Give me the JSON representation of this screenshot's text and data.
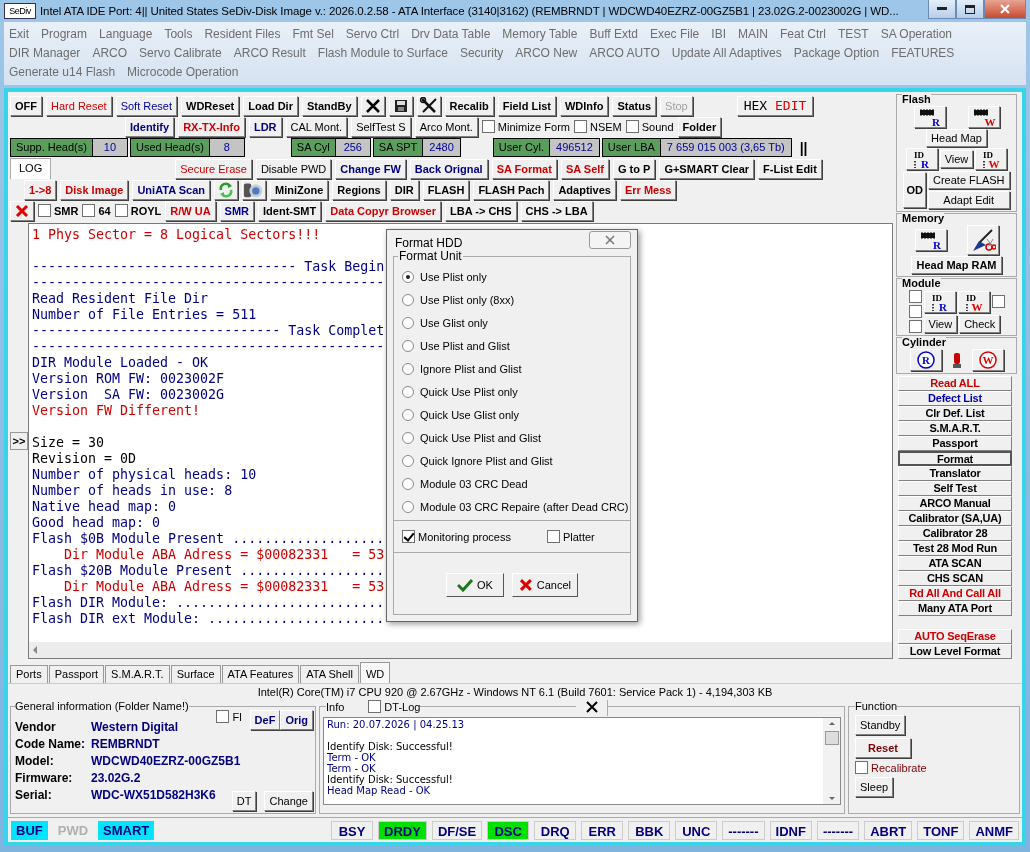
{
  "window": {
    "app_icon": "SeDiv",
    "title": "Intel ATA IDE  Port: 4|| United States  SeDiv-Disk Image v.: 2026.0.2.58 - ATA Interface (3140|3162)  (REMBRNDT | WDCWD40EZRZ-00GZ5B1 | 23.02G.2-0023002G | WD..."
  },
  "menu": [
    [
      "Exit",
      "Program",
      "Language",
      "Tools",
      "Resident Files",
      "Fmt Sel",
      "Servo Ctrl",
      "Drv Data Table",
      "Memory Table",
      "Buff Extd",
      "Exec File",
      "IBI",
      "MAIN",
      "Feat Ctrl",
      "TEST",
      "SA Operation"
    ],
    [
      "DIR Manager",
      "ARCO",
      "Servo Calibrate",
      "ARCO Result",
      "Flash Module to Surface",
      "Security",
      "ARCO New",
      "ARCO AUTO",
      "Update All Adaptives",
      "Package Option",
      "FEATURES"
    ],
    [
      "Generate u14 Flash",
      "Microcode Operation"
    ]
  ],
  "toolbar_rows": [
    [
      {
        "kind": "button",
        "label": "OFF",
        "bold": true
      },
      {
        "kind": "button",
        "label": "Hard Reset",
        "color": "#cc0000"
      },
      {
        "kind": "button",
        "label": "Soft Reset",
        "color": "#000099"
      },
      {
        "kind": "button",
        "label": "WDReset",
        "bold": true
      },
      {
        "kind": "button",
        "label": "Load Dir",
        "bold": true
      },
      {
        "kind": "button",
        "label": "StandBy",
        "bold": true
      },
      {
        "kind": "icon"
      },
      {
        "kind": "icon"
      },
      {
        "kind": "icon"
      },
      {
        "kind": "button",
        "label": "Recalib",
        "bold": true
      },
      {
        "kind": "button",
        "label": "Field List",
        "bold": true
      },
      {
        "kind": "button",
        "label": "WDInfo",
        "bold": true
      },
      {
        "kind": "button",
        "label": "Status",
        "bold": true
      },
      {
        "kind": "button",
        "label": "Stop",
        "disabled": true
      },
      {
        "kind": "hex",
        "label": "HEX",
        "label_2": "EDIT"
      }
    ],
    [
      {
        "kind": "button",
        "label": "Identify",
        "bold": true,
        "color": "#000080"
      },
      {
        "kind": "button",
        "label": "RX-TX-Info",
        "bold": true,
        "color": "#cc0000"
      },
      {
        "kind": "button",
        "label": "LDR",
        "bold": true,
        "color": "#000080"
      },
      {
        "kind": "button",
        "label": "CAL Mont."
      },
      {
        "kind": "button",
        "label": "SelfTest S"
      },
      {
        "kind": "button",
        "label": "Arco Mont."
      },
      {
        "kind": "check",
        "label": "Minimize Form",
        "checked": false
      },
      {
        "kind": "check",
        "label": "NSEM",
        "checked": false
      },
      {
        "kind": "check",
        "label": "Sound",
        "checked": false
      },
      {
        "kind": "button",
        "label": "Folder",
        "bold": true
      }
    ],
    [
      {
        "kind": "field",
        "label": "Supp. Head(s)",
        "value": "10"
      },
      {
        "kind": "field",
        "label": "Used Head(s)",
        "value": "8"
      },
      {
        "kind": "field",
        "label": "SA Cyl",
        "value": "256"
      },
      {
        "kind": "field",
        "label": "SA SPT",
        "value": "2480"
      },
      {
        "kind": "field",
        "label": "User Cyl.",
        "value": "496512"
      },
      {
        "kind": "field",
        "label": "User LBA",
        "value": "7 659 015 003  (3,65 Tb)"
      },
      {
        "kind": "mark",
        "label": "||"
      }
    ],
    [
      {
        "kind": "tab",
        "label": "LOG",
        "selected": true
      },
      {
        "kind": "button",
        "label": "Secure Erase",
        "color": "#cc0000"
      },
      {
        "kind": "button",
        "label": "Disable PWD"
      },
      {
        "kind": "button",
        "label": "Change FW",
        "bold": true,
        "color": "#000080"
      },
      {
        "kind": "button",
        "label": "Back Orignal",
        "bold": true,
        "color": "#000080"
      },
      {
        "kind": "button",
        "label": "SA Format",
        "bold": true,
        "color": "#cc0000"
      },
      {
        "kind": "button",
        "label": "SA Self",
        "bold": true,
        "color": "#cc0000"
      },
      {
        "kind": "button",
        "label": "G to P",
        "bold": true
      },
      {
        "kind": "button",
        "label": "G+SMART Clear",
        "bold": true
      },
      {
        "kind": "button",
        "label": "F-List Edit",
        "bold": true
      }
    ],
    [
      {
        "kind": "button",
        "label": "1->8",
        "bold": true,
        "color": "#cc0000"
      },
      {
        "kind": "button",
        "label": "Disk Image",
        "bold": true,
        "color": "#cc0000"
      },
      {
        "kind": "button",
        "label": "UniATA Scan",
        "bold": true,
        "color": "#000080"
      },
      {
        "kind": "icon"
      },
      {
        "kind": "icon"
      },
      {
        "kind": "button",
        "label": "MiniZone",
        "bold": true
      },
      {
        "kind": "button",
        "label": "Regions",
        "bold": true
      },
      {
        "kind": "button",
        "label": "DIR",
        "bold": true
      },
      {
        "kind": "button",
        "label": "FLASH",
        "bold": true
      },
      {
        "kind": "button",
        "label": "FLASH Pach",
        "bold": true
      },
      {
        "kind": "button",
        "label": "Adaptives",
        "bold": true
      },
      {
        "kind": "button",
        "label": "Err Mess",
        "bold": true,
        "color": "#cc0000"
      }
    ],
    [
      {
        "kind": "icon"
      },
      {
        "kind": "check",
        "label": "SMR",
        "checked": false,
        "bold": true
      },
      {
        "kind": "check",
        "label": "64",
        "checked": false,
        "bold": true
      },
      {
        "kind": "check",
        "label": "ROYL",
        "checked": false,
        "bold": true
      },
      {
        "kind": "button",
        "label": "R/W UA",
        "bold": true,
        "color": "#cc0000"
      },
      {
        "kind": "button",
        "label": "SMR",
        "bold": true,
        "color": "#000080"
      },
      {
        "kind": "button",
        "label": "Ident-SMT",
        "bold": true
      },
      {
        "kind": "button",
        "label": "Data Copyr Browser",
        "bold": true,
        "color": "#cc0000"
      },
      {
        "kind": "button",
        "label": "LBA -> CHS",
        "bold": true
      },
      {
        "kind": "button",
        "label": "CHS -> LBA",
        "bold": true
      }
    ]
  ],
  "log": {
    "expand_button": ">>",
    "lines": [
      {
        "text": "1 Phys Sector = 8 Logical Sectors!!!",
        "color": "#cc0000"
      },
      {
        "kind": "blank"
      },
      {
        "text": "--------------------------------- Task Begin",
        "color": "#000080"
      },
      {
        "text": "--------------------------------------------",
        "color": "#000080"
      },
      {
        "text": "Read Resident File Dir",
        "color": "#000080"
      },
      {
        "text": "Number of File Entries = 511",
        "color": "#000080"
      },
      {
        "text": "------------------------------- Task Complet",
        "color": "#000080"
      },
      {
        "text": "--------------------------------------------",
        "color": "#000080"
      },
      {
        "text": "DIR Module Loaded - OK",
        "color": "#000080"
      },
      {
        "text": "Version ROM FW: 0023002F",
        "color": "#000080"
      },
      {
        "text": "Version  SA FW: 0023002G",
        "color": "#000080"
      },
      {
        "text": "Version FW Different!",
        "color": "#cc0000"
      },
      {
        "kind": "blank"
      },
      {
        "text": "Size = 30",
        "color": "#000000"
      },
      {
        "text": "Revision = 0D",
        "color": "#000000"
      },
      {
        "text": "Number of physical heads: 10",
        "color": "#000080"
      },
      {
        "text": "Number of heads in use: 8",
        "color": "#000080"
      },
      {
        "text": "Native head map: 0",
        "color": "#000080"
      },
      {
        "text": "Good head map: 0",
        "color": "#000080"
      },
      {
        "text": "Flash $0B Module Present ...................",
        "color": "#000080"
      },
      {
        "text": "    Dir Module ABA Adress = $00082331   = 53",
        "color": "#cc0000"
      },
      {
        "text": "Flash $20B Module Present ..................",
        "color": "#000080"
      },
      {
        "text": "    Dir Module ABA Adress = $00082331   = 53",
        "color": "#cc0000"
      },
      {
        "text": "Flash DIR Module: ..........................",
        "color": "#000080"
      },
      {
        "text": "Flash DIR ext Module: ......................",
        "color": "#000080"
      }
    ]
  },
  "dialog": {
    "title": "Format HDD",
    "group": "Format Unit",
    "options": [
      {
        "label": "Use Plist only",
        "selected": true
      },
      {
        "label": "Use Plist only (8xx)",
        "selected": false
      },
      {
        "label": "Use Glist only",
        "selected": false
      },
      {
        "label": "Use Plist and Glist",
        "selected": false
      },
      {
        "label": "Ignore Plist and Glist",
        "selected": false
      },
      {
        "label": "Quick Use Plist only",
        "selected": false
      },
      {
        "label": "Quick Use Glist only",
        "selected": false
      },
      {
        "label": "Quick Use Plist and Glist",
        "selected": false
      },
      {
        "label": "Quick Ignore Plist and Glist",
        "selected": false
      },
      {
        "label": "Module 03 CRC Dead",
        "selected": false
      },
      {
        "label": "Module 03 CRC Repaire (after Dead CRC)",
        "selected": false
      }
    ],
    "checks": [
      {
        "label": "Monitoring process",
        "checked": true
      },
      {
        "label": "Platter",
        "checked": false
      }
    ],
    "ok": "OK",
    "cancel": "Cancel"
  },
  "right_panel": {
    "flash": {
      "title": "Flash",
      "head_map": "Head Map",
      "id_read": {
        "top": "ID",
        "letter": "R"
      },
      "view": "View",
      "id_write": {
        "top": "ID",
        "letter": "W"
      },
      "od": "OD",
      "create": "Create FLASH",
      "adapt": "Adapt Edit",
      "chip_read": "R",
      "chip_write": "W"
    },
    "memory": {
      "title": "Memory",
      "chip_read": "R",
      "head_map_ram": "Head Map RAM"
    },
    "module": {
      "title": "Module",
      "checks": [
        false,
        false,
        false,
        false
      ],
      "id_read": {
        "top": "ID",
        "letter": "R"
      },
      "id_write": {
        "top": "ID",
        "letter": "W"
      },
      "view": "View",
      "check": "Check"
    },
    "cylinder": {
      "title": "Cylinder",
      "read": "R",
      "write": "W"
    },
    "buttons": [
      {
        "label": "Read ALL",
        "color": "#cc0000",
        "selected": false
      },
      {
        "label": "Defect List",
        "color": "#0000aa",
        "selected": false
      },
      {
        "label": "Clr Def. List",
        "selected": false
      },
      {
        "label": "S.M.A.R.T.",
        "selected": false
      },
      {
        "label": "Passport",
        "selected": false
      },
      {
        "label": "Format",
        "selected": true
      },
      {
        "label": "Translator",
        "selected": false
      },
      {
        "label": "Self Test",
        "selected": false
      },
      {
        "label": "ARCO Manual",
        "selected": false
      },
      {
        "label": "Calibrator (SA,UA)",
        "selected": false
      },
      {
        "label": "Calibrator 28",
        "selected": false
      },
      {
        "label": "Test 28 Mod Run",
        "selected": false
      },
      {
        "label": "ATA SCAN",
        "selected": false
      },
      {
        "label": "CHS SCAN",
        "selected": false
      },
      {
        "label": "Rd All And Call All",
        "color": "#cc0000",
        "selected": false
      },
      {
        "label": "Many ATA Port",
        "selected": false
      }
    ],
    "bottom_buttons": [
      {
        "label": "AUTO SeqErase",
        "color": "#cc0000",
        "selected": false
      },
      {
        "label": "Low Level Format",
        "selected": false
      }
    ]
  },
  "bottom_tabs": [
    {
      "label": "Ports",
      "selected": false
    },
    {
      "label": "Passport",
      "selected": false
    },
    {
      "label": "S.M.A.R.T.",
      "selected": false
    },
    {
      "label": "Surface",
      "selected": false
    },
    {
      "label": "ATA Features",
      "selected": false
    },
    {
      "label": "ATA Shell",
      "selected": false
    },
    {
      "label": "WD",
      "selected": true
    }
  ],
  "system_info": "Intel(R) Core(TM) i7 CPU 920  @ 2.67GHz - Windows NT 6.1 (Build 7601: Service Pack 1) -  4,194,303 KB",
  "general_info": {
    "title": "General information (Folder Name!)",
    "fl_check": {
      "label": "Fl",
      "checked": false
    },
    "def": "DeF",
    "orig": "Orig",
    "rows": [
      {
        "label": "Vendor",
        "value": "Western Digital"
      },
      {
        "label": "Code Name:",
        "value": "REMBRNDT"
      },
      {
        "label": "Model:",
        "value": "WDCWD40EZRZ-00GZ5B1"
      },
      {
        "label": "Firmware:",
        "value": "23.02G.2"
      },
      {
        "label": "Serial:",
        "value": "WDC-WX51D582H3K6"
      }
    ],
    "dt": "DT",
    "change": "Change"
  },
  "info": {
    "title": "Info",
    "dt_log": {
      "label": "DT-Log",
      "checked": false
    },
    "lines": [
      {
        "text": "Run: 20.07.2026 | 04.25.13",
        "color": "#000080"
      },
      {
        "kind": "blank"
      },
      {
        "text": "Identify Disk: Successful!",
        "color": "#000000"
      },
      {
        "text": "Term - OK",
        "color": "#000080"
      },
      {
        "text": "Term - OK",
        "color": "#000080"
      },
      {
        "text": "Identify Disk: Successful!",
        "color": "#000000"
      },
      {
        "text": "Head Map Read - OK",
        "color": "#000080"
      }
    ]
  },
  "function": {
    "title": "Function",
    "standby": "Standby",
    "reset": "Reset",
    "recalibrate": {
      "label": "Recalibrate",
      "checked": false
    },
    "sleep": "Sleep"
  },
  "status_bar": {
    "left": [
      {
        "label": "BUF",
        "color": "#00e5ff"
      },
      {
        "label": "PWD",
        "disabled": true
      },
      {
        "label": "SMART",
        "color": "#00e5ff"
      }
    ],
    "right": [
      {
        "label": "BSY"
      },
      {
        "label": "DRDY",
        "color": "#00e000"
      },
      {
        "label": "DF/SE"
      },
      {
        "label": "DSC",
        "color": "#00e000"
      },
      {
        "label": "DRQ"
      },
      {
        "label": "ERR"
      },
      {
        "label": "BBK"
      },
      {
        "label": "UNC"
      },
      {
        "label": "-------"
      },
      {
        "label": "IDNF"
      },
      {
        "label": "-------"
      },
      {
        "label": "ABRT"
      },
      {
        "label": "TONF"
      },
      {
        "label": "ANMF"
      }
    ]
  }
}
